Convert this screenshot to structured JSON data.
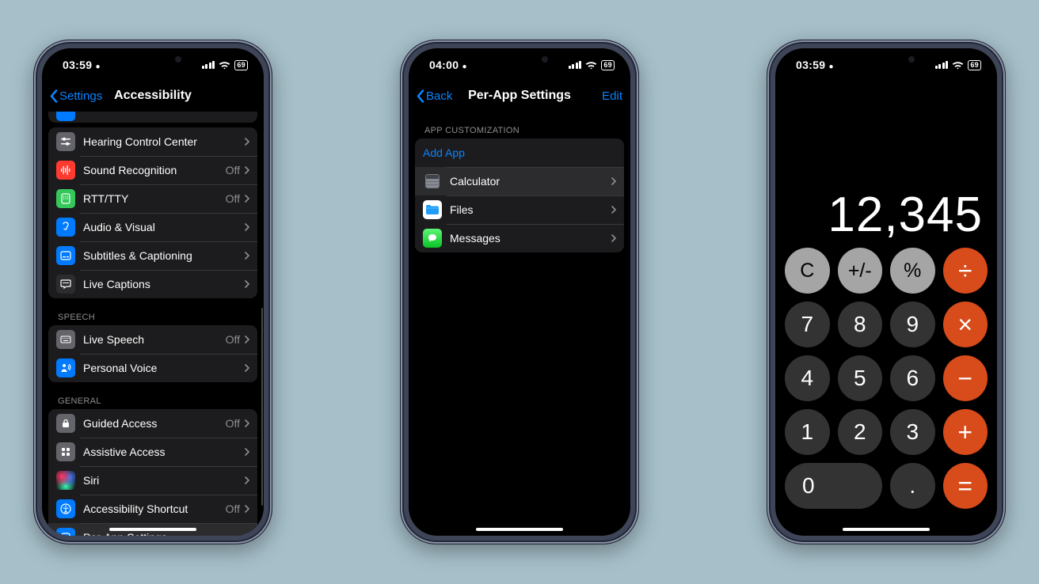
{
  "phone1": {
    "status": {
      "time": "03:59",
      "battery": "69"
    },
    "back_label": "Settings",
    "title": "Accessibility",
    "hearing_group": [
      {
        "key": "hearing-control-center",
        "icon": "slider-icon",
        "bg": "bg-gray",
        "label": "Hearing Control Center",
        "value": ""
      },
      {
        "key": "sound-recognition",
        "icon": "waveform-icon",
        "bg": "bg-red",
        "label": "Sound Recognition",
        "value": "Off"
      },
      {
        "key": "rtt-tty",
        "icon": "phone-icon",
        "bg": "bg-green",
        "label": "RTT/TTY",
        "value": "Off"
      },
      {
        "key": "audio-visual",
        "icon": "ear-icon",
        "bg": "bg-blue",
        "label": "Audio & Visual",
        "value": ""
      },
      {
        "key": "subtitles-captioning",
        "icon": "cc-icon",
        "bg": "bg-blue",
        "label": "Subtitles & Captioning",
        "value": ""
      },
      {
        "key": "live-captions",
        "icon": "bubble-icon",
        "bg": "bg-dark",
        "label": "Live Captions",
        "value": ""
      }
    ],
    "speech_header": "Speech",
    "speech_group": [
      {
        "key": "live-speech",
        "icon": "keyboard-icon",
        "bg": "bg-gray",
        "label": "Live Speech",
        "value": "Off"
      },
      {
        "key": "personal-voice",
        "icon": "person-wave-icon",
        "bg": "bg-blue",
        "label": "Personal Voice",
        "value": ""
      }
    ],
    "general_header": "General",
    "general_group": [
      {
        "key": "guided-access",
        "icon": "lock-icon",
        "bg": "bg-gray",
        "label": "Guided Access",
        "value": "Off"
      },
      {
        "key": "assistive-access",
        "icon": "grid-icon",
        "bg": "bg-gray",
        "label": "Assistive Access",
        "value": ""
      },
      {
        "key": "siri",
        "icon": "siri-icon",
        "bg": "bg-siri",
        "label": "Siri",
        "value": ""
      },
      {
        "key": "accessibility-shortcut",
        "icon": "accessibility-icon",
        "bg": "bg-blue",
        "label": "Accessibility Shortcut",
        "value": "Off"
      },
      {
        "key": "per-app-settings",
        "icon": "app-badge-icon",
        "bg": "bg-blue",
        "label": "Per-App Settings",
        "value": "",
        "highlight": true
      }
    ]
  },
  "phone2": {
    "status": {
      "time": "04:00",
      "battery": "69"
    },
    "back_label": "Back",
    "title": "Per-App Settings",
    "edit_label": "Edit",
    "section_header": "App Customization",
    "add_app_label": "Add App",
    "apps": [
      {
        "key": "calculator",
        "label": "Calculator",
        "icon": "calculator-app-icon",
        "highlight": true
      },
      {
        "key": "files",
        "label": "Files",
        "icon": "files-app-icon"
      },
      {
        "key": "messages",
        "label": "Messages",
        "icon": "messages-app-icon"
      }
    ]
  },
  "phone3": {
    "status": {
      "time": "03:59",
      "battery": "69"
    },
    "display": "12,345",
    "buttons": [
      {
        "key": "clear",
        "label": "C",
        "cls": "light"
      },
      {
        "key": "plusminus",
        "label": "+/-",
        "cls": "light"
      },
      {
        "key": "percent",
        "label": "%",
        "cls": "light"
      },
      {
        "key": "divide",
        "label": "÷",
        "cls": "orange"
      },
      {
        "key": "seven",
        "label": "7",
        "cls": "dark"
      },
      {
        "key": "eight",
        "label": "8",
        "cls": "dark"
      },
      {
        "key": "nine",
        "label": "9",
        "cls": "dark"
      },
      {
        "key": "multiply",
        "label": "×",
        "cls": "orange"
      },
      {
        "key": "four",
        "label": "4",
        "cls": "dark"
      },
      {
        "key": "five",
        "label": "5",
        "cls": "dark"
      },
      {
        "key": "six",
        "label": "6",
        "cls": "dark"
      },
      {
        "key": "minus",
        "label": "−",
        "cls": "orange"
      },
      {
        "key": "one",
        "label": "1",
        "cls": "dark"
      },
      {
        "key": "two",
        "label": "2",
        "cls": "dark"
      },
      {
        "key": "three",
        "label": "3",
        "cls": "dark"
      },
      {
        "key": "plus",
        "label": "+",
        "cls": "orange"
      },
      {
        "key": "zero",
        "label": "0",
        "cls": "dark zero"
      },
      {
        "key": "decimal",
        "label": ".",
        "cls": "dark"
      },
      {
        "key": "equals",
        "label": "=",
        "cls": "orange"
      }
    ]
  }
}
